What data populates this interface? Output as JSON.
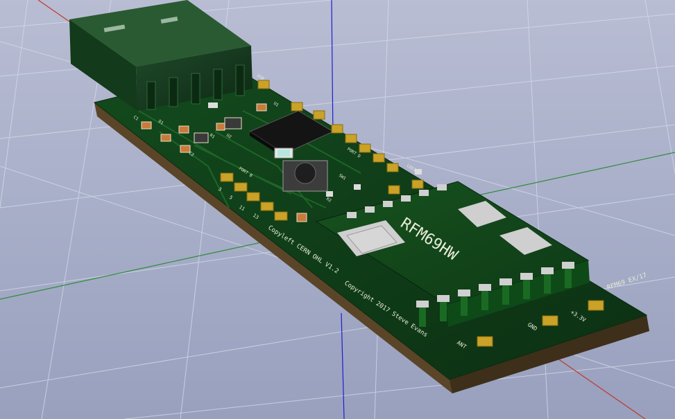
{
  "viewer": {
    "background_top": "#b7bcd2",
    "background_bottom": "#9aa2c0",
    "axis_colors": {
      "x": "#c0392b",
      "y": "#2e8b3a",
      "z": "#2222cc"
    }
  },
  "board": {
    "solder_mask": "#0f3a16",
    "pad_gold": "#c9a227",
    "substrate": "#5a4528",
    "copyright_main": "Copyright 2017 Steve Evans",
    "copyright_sub": "Copyleft CERN OHL V1.2",
    "module_label": "RFM69HW",
    "version_label": "RFM69 EX/17"
  },
  "pin_labels": {
    "ant": "ANT",
    "gnd": "GND",
    "v33": "+3.3V",
    "p3": "3",
    "p5": "5",
    "p11": "11",
    "p13": "13"
  },
  "component_labels": {
    "u1": "U1",
    "sw1": "SW1",
    "port_b": "PORT B",
    "port_d": "PORT D",
    "led": "LED1",
    "c1": "C1",
    "c2": "C2",
    "r1": "R1",
    "r2": "R2",
    "d1": "D1",
    "u2": "U2",
    "usb": "USB"
  }
}
